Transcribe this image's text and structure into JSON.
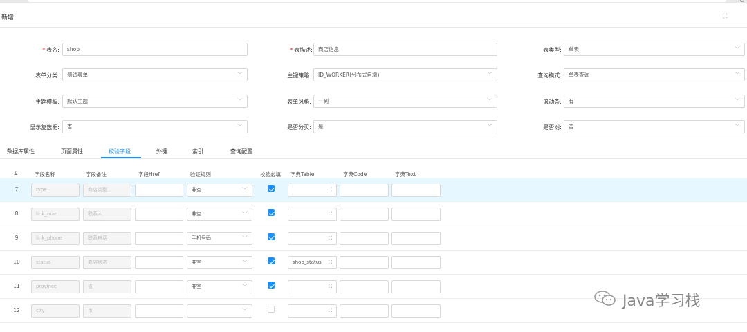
{
  "modal": {
    "title": "新增"
  },
  "form": {
    "table_name": {
      "label": "表名:",
      "value": "shop"
    },
    "table_desc": {
      "label": "表描述:",
      "value": "商店信息"
    },
    "table_type": {
      "label": "表类型:",
      "value": "单表"
    },
    "form_category": {
      "label": "表单分类:",
      "value": "测试表单"
    },
    "pk_strategy": {
      "label": "主键策略:",
      "value": "ID_WORKER(分布式自增)"
    },
    "query_mode": {
      "label": "查询模式:",
      "value": "单表查询"
    },
    "theme_template": {
      "label": "主题模板:",
      "value": "默认主题"
    },
    "form_style": {
      "label": "表单风格:",
      "value": "一列"
    },
    "scrollbar": {
      "label": "滚动条:",
      "value": "有"
    },
    "show_checkbox": {
      "label": "显示复选框:",
      "value": "否"
    },
    "paginate": {
      "label": "是否分页:",
      "value": "是"
    },
    "is_tree": {
      "label": "是否树:",
      "value": "否"
    }
  },
  "tabs": [
    "数据库属性",
    "页面属性",
    "校验字段",
    "外键",
    "索引",
    "查询配置"
  ],
  "active_tab": "校验字段",
  "table": {
    "headers": [
      "#",
      "字段名称",
      "字段备注",
      "字段Href",
      "验证规则",
      "校验必填",
      "字典Table",
      "字典Code",
      "字典Text"
    ],
    "rows": [
      {
        "no": "7",
        "name": "type",
        "remark": "商店类型",
        "rule": "非空",
        "required": true,
        "dict_table": ""
      },
      {
        "no": "8",
        "name": "link_man",
        "remark": "联系人",
        "rule": "非空",
        "required": true,
        "dict_table": ""
      },
      {
        "no": "9",
        "name": "link_phone",
        "remark": "联系电话",
        "rule": "手机号码",
        "required": true,
        "dict_table": ""
      },
      {
        "no": "10",
        "name": "status",
        "remark": "商店状态",
        "rule": "非空",
        "required": true,
        "dict_table": "shop_status"
      },
      {
        "no": "11",
        "name": "province",
        "remark": "省",
        "rule": "非空",
        "required": true,
        "dict_table": ""
      },
      {
        "no": "12",
        "name": "city",
        "remark": "市",
        "rule": "",
        "required": false,
        "dict_table": ""
      }
    ]
  },
  "watermark": {
    "text": "Java学习栈"
  },
  "icons": {
    "fullscreen": "expand-icon",
    "select_arrow": "chevron-down-icon",
    "dict_expand": "expand-icon",
    "watermark": "wechat-logo-icon"
  },
  "colors": {
    "primary": "#1890ff",
    "required": "#f5222d",
    "highlight_row": "#e6f7ff"
  }
}
